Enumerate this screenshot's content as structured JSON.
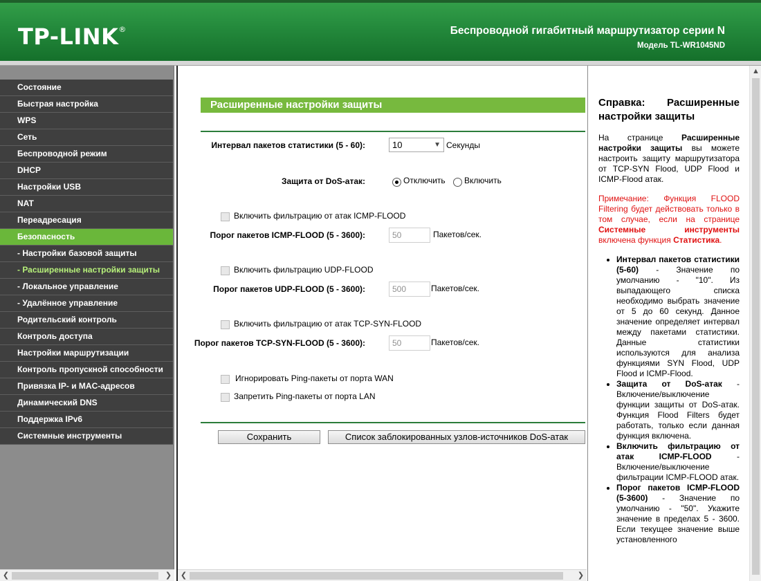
{
  "header": {
    "logo": "TP-LINK",
    "logo_mark": "®",
    "product_title": "Беспроводной гигабитный маршрутизатор серии N",
    "model": "Модель TL-WR1045ND"
  },
  "colors": {
    "header_green": "#248a3c",
    "menu_dark": "#3f3f3f",
    "menu_active": "#6ab73a",
    "title_bar": "#77b93e",
    "note_red": "#e01010"
  },
  "menu": {
    "items": [
      {
        "label": "Состояние"
      },
      {
        "label": "Быстрая настройка"
      },
      {
        "label": "WPS"
      },
      {
        "label": "Сеть"
      },
      {
        "label": "Беспроводной режим"
      },
      {
        "label": "DHCP"
      },
      {
        "label": "Настройки USB"
      },
      {
        "label": "NAT"
      },
      {
        "label": "Переадресация"
      },
      {
        "label": "Безопасность"
      },
      {
        "label": "- Настройки базовой защиты"
      },
      {
        "label": "- Расширенные настройки защиты"
      },
      {
        "label": "- Локальное управление"
      },
      {
        "label": "- Удалённое управление"
      },
      {
        "label": "Родительский контроль"
      },
      {
        "label": "Контроль доступа"
      },
      {
        "label": "Настройки маршрутизации"
      },
      {
        "label": "Контроль пропускной способности"
      },
      {
        "label": "Привязка IP- и MAC-адресов"
      },
      {
        "label": "Динамический DNS"
      },
      {
        "label": "Поддержка IPv6"
      },
      {
        "label": "Системные инструменты"
      }
    ]
  },
  "main": {
    "title": "Расширенные настройки защиты",
    "stat_interval_label": "Интервал пакетов статистики (5 - 60):",
    "stat_interval_value": "10",
    "stat_interval_unit": "Секунды",
    "dos_label": "Защита от DoS-атак:",
    "dos_off": "Отключить",
    "dos_on": "Включить",
    "icmp_enable": "Включить фильтрацию от атак ICMP-FLOOD",
    "icmp_threshold_label": "Порог пакетов ICMP-FLOOD (5 - 3600):",
    "icmp_threshold_value": "50",
    "icmp_unit": "Пакетов/сек.",
    "udp_enable": "Включить фильтрацию UDP-FLOOD",
    "udp_threshold_label": "Порог пакетов UDP-FLOOD (5 - 3600):",
    "udp_threshold_value": "500",
    "udp_unit": "Пакетов/сек.",
    "tcp_enable": "Включить фильтрацию от атак TCP-SYN-FLOOD",
    "tcp_threshold_label": "Порог пакетов TCP-SYN-FLOOD (5 - 3600):",
    "tcp_threshold_value": "50",
    "tcp_unit": "Пакетов/сек.",
    "ignore_wan_ping": "Игнорировать Ping-пакеты от порта WAN",
    "forbid_lan_ping": "Запретить Ping-пакеты от порта LAN",
    "save_button": "Сохранить",
    "blocked_list_button": "Список заблокированных узлов-источников DoS-атак"
  },
  "help": {
    "title": "Справка: Расширенные настройки защиты",
    "intro_1": "На странице ",
    "intro_bold": "Расширенные настройки защиты",
    "intro_2": " вы можете настроить защиту маршрутизатора от TCP-SYN Flood, UDP Flood и ICMP-Flood атак.",
    "note_1": "Примечание: Функция FLOOD Filtering будет действовать только в том случае, если на странице ",
    "note_bold_1": "Системные инструменты",
    "note_2": " включена функция ",
    "note_bold_2": "Статистика",
    "note_3": ".",
    "items": [
      {
        "term": "Интервал пакетов статистики (5-60)",
        "text": " - Значение по умолчанию - \"10\". Из выпадающего списка необходимо выбрать значение от 5 до 60 секунд. Данное значение определяет интервал между пакетами статистики. Данные статистики используются для анализа функциями SYN Flood, UDP Flood и ICMP-Flood."
      },
      {
        "term": "Защита от DoS-атак",
        "text": " - Включение/выключение функции защиты от DoS-атак. Функция Flood Filters будет работать, только если данная функция включена."
      },
      {
        "term": "Включить фильтрацию от атак ICMP-FLOOD",
        "text": " - Включение/выключение фильтрации ICMP-FLOOD атак."
      },
      {
        "term": "Порог пакетов ICMP-FLOOD (5-3600)",
        "text": " - Значение по умолчанию - \"50\". Укажите значение в пределах 5 - 3600. Если текущее значение выше установленного"
      }
    ]
  }
}
